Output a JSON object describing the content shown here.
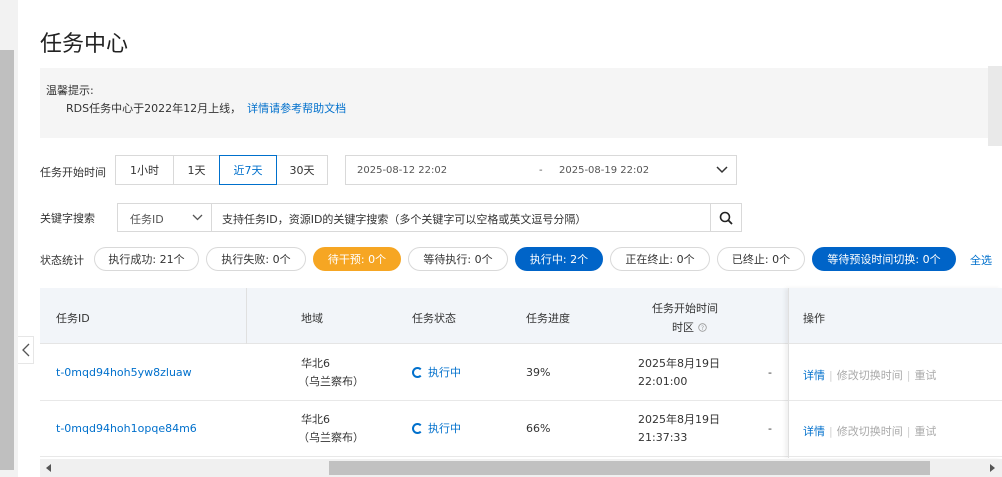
{
  "page": {
    "title": "任务中心"
  },
  "tips": {
    "heading": "温馨提示:",
    "text": "RDS任务中心于2022年12月上线，",
    "link": "详情请参考帮助文档"
  },
  "filters": {
    "time_label": "任务开始时间",
    "time_options": [
      "1小时",
      "1天",
      "近7天",
      "30天"
    ],
    "time_active": "近7天",
    "date_start": "2025-08-12 22:02",
    "date_sep": "-",
    "date_end": "2025-08-19 22:02",
    "keyword_label": "关键字搜索",
    "keyword_type": "任务ID",
    "keyword_placeholder": "支持任务ID，资源ID的关键字搜索（多个关键字可以空格或英文逗号分隔）"
  },
  "status": {
    "label": "状态统计",
    "pills": [
      {
        "text": "执行成功: 21个",
        "style": "default"
      },
      {
        "text": "执行失败: 0个",
        "style": "default"
      },
      {
        "text": "待干预: 0个",
        "style": "orange"
      },
      {
        "text": "等待执行: 0个",
        "style": "default"
      },
      {
        "text": "执行中: 2个",
        "style": "blue"
      },
      {
        "text": "正在终止: 0个",
        "style": "default"
      },
      {
        "text": "已终止: 0个",
        "style": "default"
      },
      {
        "text": "等待预设时间切换: 0个",
        "style": "blue"
      }
    ],
    "select_all": "全选"
  },
  "table": {
    "headers": {
      "task_id": "任务ID",
      "region": "地域",
      "status": "任务状态",
      "progress": "任务进度",
      "start_time": "任务开始时间",
      "timezone": "时区",
      "ops": "操作"
    },
    "rows": [
      {
        "task_id": "t-0mqd94hoh5yw8zluaw",
        "region_1": "华北6",
        "region_2": "（乌兰察布）",
        "status": "执行中",
        "progress": "39%",
        "date": "2025年8月19日",
        "time": "22:01:00",
        "extra": "-"
      },
      {
        "task_id": "t-0mqd94hoh1opqe84m6",
        "region_1": "华北6",
        "region_2": "（乌兰察布）",
        "status": "执行中",
        "progress": "66%",
        "date": "2025年8月19日",
        "time": "21:37:33",
        "extra": "-"
      }
    ],
    "actions": {
      "detail": "详情",
      "modify": "修改切换时间",
      "retry": "重试"
    }
  },
  "colors": {
    "accent": "#0070cc",
    "orange": "#f6a623",
    "blue": "#0064c8"
  }
}
